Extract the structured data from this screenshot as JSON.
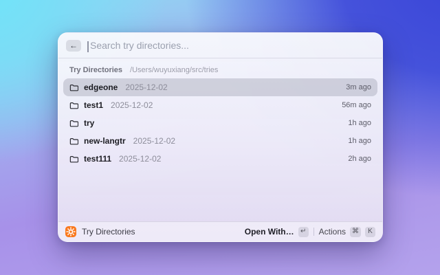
{
  "background": {
    "top_left_color": "#72e7f9",
    "top_right_color": "#4350da",
    "bottom_left_color": "#a28ce8",
    "bottom_right_color": "#b5a3ec"
  },
  "window": {
    "search": {
      "back_icon": "←",
      "placeholder": "Search try directories...",
      "value": ""
    },
    "list": {
      "section_title": "Try Directories",
      "section_path": "/Users/wuyuxiang/src/tries",
      "rows": [
        {
          "name": "edgeone",
          "date": "2025-12-02",
          "time": "3m ago",
          "selected": true
        },
        {
          "name": "test1",
          "date": "2025-12-02",
          "time": "56m ago",
          "selected": false
        },
        {
          "name": "try",
          "date": "",
          "time": "1h ago",
          "selected": false
        },
        {
          "name": "new-langtr",
          "date": "2025-12-02",
          "time": "1h ago",
          "selected": false
        },
        {
          "name": "test111",
          "date": "2025-12-02",
          "time": "2h ago",
          "selected": false
        }
      ]
    },
    "footer": {
      "app_icon": "gear-icon",
      "app_icon_color": "#f9791f",
      "app_label": "Try Directories",
      "primary_action": "Open With…",
      "primary_key": "↵",
      "secondary_action": "Actions",
      "secondary_key_1": "⌘",
      "secondary_key_2": "K"
    }
  }
}
